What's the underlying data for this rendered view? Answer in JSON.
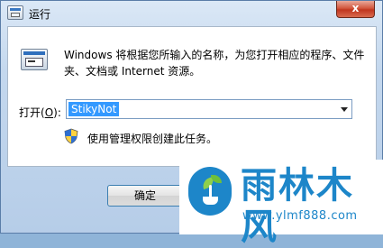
{
  "window": {
    "title": "运行",
    "close_label": "x"
  },
  "dialog": {
    "description": "Windows 将根据您所输入的名称，为您打开相应的程序、文件夹、文档或 Internet 资源。",
    "open_label_prefix": "打开(",
    "open_label_key": "O",
    "open_label_suffix": "):",
    "command_value": "StikyNot",
    "admin_note": "使用管理权限创建此任务。",
    "ok_label": "确定"
  },
  "watermark": {
    "brand": "雨林木风",
    "url": "www.ylmf888.com"
  },
  "colors": {
    "accent": "#1d86c9",
    "selection": "#3399ff",
    "close_button": "#c0361f"
  }
}
